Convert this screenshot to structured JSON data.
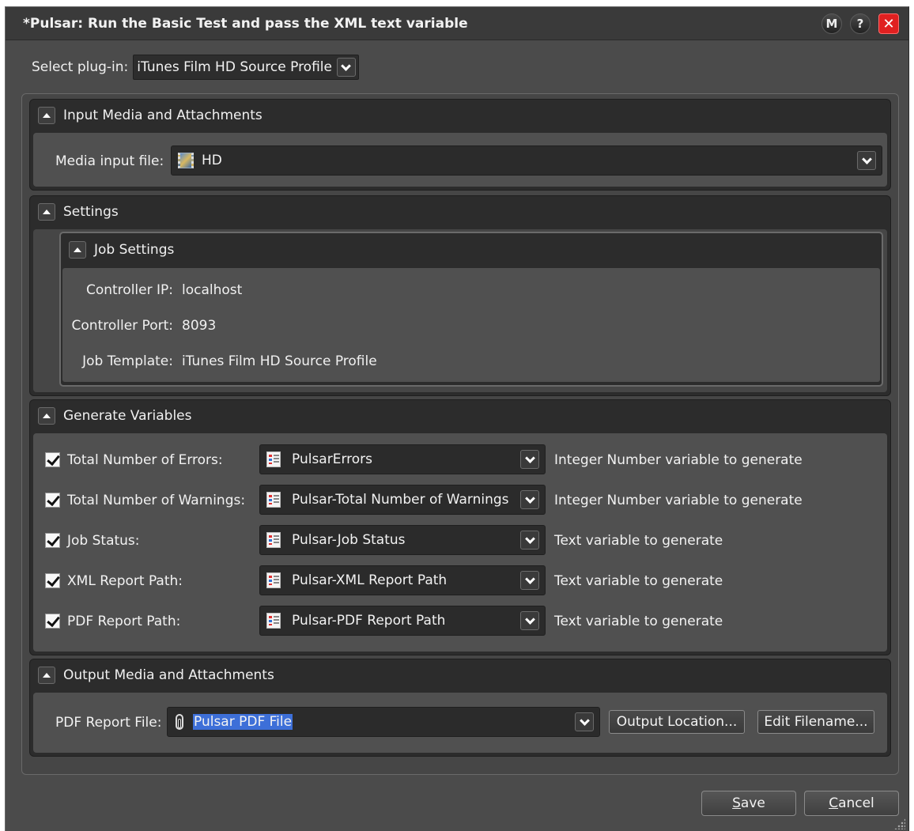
{
  "window": {
    "title": "*Pulsar: Run the Basic Test and pass the XML text variable",
    "buttons": {
      "m": "M",
      "help": "?",
      "close": "✕"
    }
  },
  "plugin": {
    "label": "Select plug-in:",
    "value": "iTunes Film HD Source Profile"
  },
  "sections": {
    "input_media": {
      "title": "Input Media and Attachments",
      "media_label": "Media input file:",
      "media_value": "HD",
      "media_icon": "film-clip-icon"
    },
    "settings": {
      "title": "Settings",
      "job_settings": {
        "title": "Job Settings",
        "controller_ip_label": "Controller IP:",
        "controller_ip": "localhost",
        "controller_port_label": "Controller Port:",
        "controller_port": "8093",
        "job_template_label": "Job Template:",
        "job_template": "iTunes Film HD Source Profile"
      }
    },
    "generate_variables": {
      "title": "Generate Variables",
      "rows": [
        {
          "checked": true,
          "label": "Total Number of Errors:",
          "variable": "PulsarErrors",
          "description": "Integer Number variable to generate"
        },
        {
          "checked": true,
          "label": "Total Number of Warnings:",
          "variable": "Pulsar-Total Number of Warnings",
          "description": "Integer Number variable to generate"
        },
        {
          "checked": true,
          "label": "Job Status:",
          "variable": "Pulsar-Job Status",
          "description": "Text variable to generate"
        },
        {
          "checked": true,
          "label": "XML Report Path:",
          "variable": "Pulsar-XML Report Path",
          "description": "Text variable to generate"
        },
        {
          "checked": true,
          "label": "PDF Report Path:",
          "variable": "Pulsar-PDF Report Path",
          "description": "Text variable to generate"
        }
      ]
    },
    "output_media": {
      "title": "Output Media and Attachments",
      "pdf_label": "PDF Report File:",
      "pdf_value": "Pulsar PDF File",
      "output_location_button": "Output Location...",
      "edit_filename_button": "Edit Filename..."
    }
  },
  "footer": {
    "save_mnemonic": "S",
    "save_rest": "ave",
    "cancel_mnemonic": "C",
    "cancel_rest": "ancel"
  },
  "colors": {
    "close_red": "#e02020",
    "selection_blue": "#3d6fd8",
    "window_bg": "#4b4b4b",
    "header_bg": "#2c2c2c"
  }
}
